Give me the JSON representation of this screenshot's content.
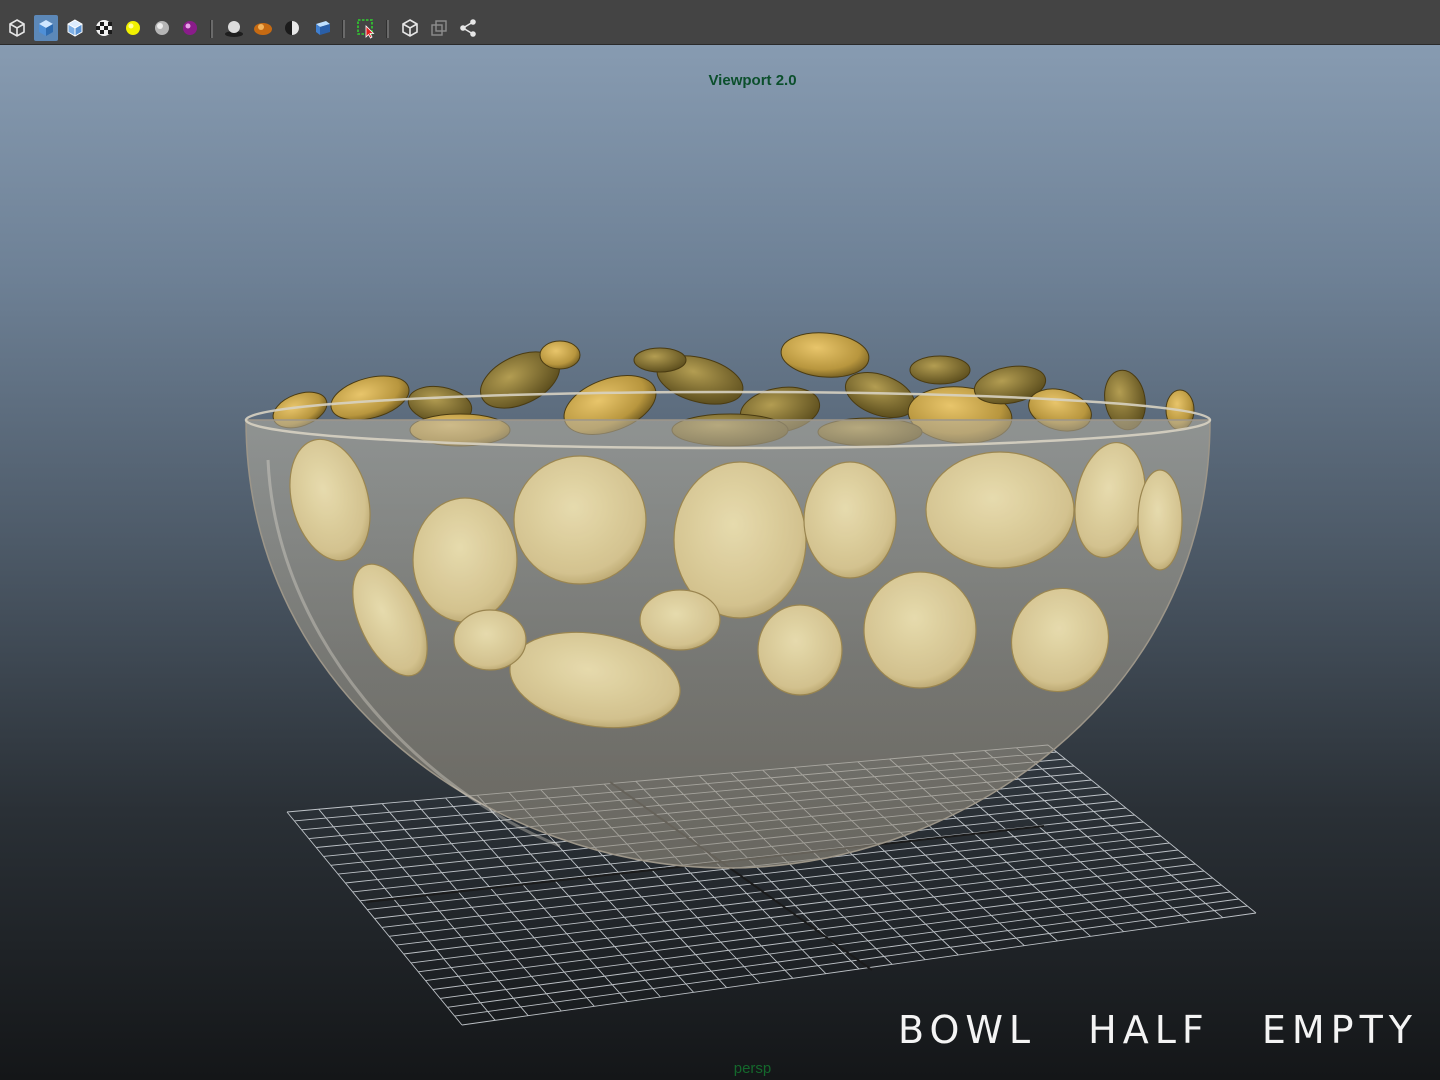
{
  "toolbar": {
    "tools": [
      {
        "icon": "wireframe-cube-icon",
        "active": false
      },
      {
        "icon": "smooth-shade-cube-icon",
        "active": true
      },
      {
        "icon": "wireframe-on-shaded-icon",
        "active": false
      },
      {
        "icon": "textured-checker-icon",
        "active": false
      },
      {
        "icon": "use-all-lights-icon",
        "active": false
      },
      {
        "icon": "default-material-sphere-icon",
        "active": false
      },
      {
        "icon": "shaded-material-sphere-icon",
        "active": false
      },
      {
        "icon": "shadows-icon",
        "active": false
      },
      {
        "icon": "screen-space-ao-icon",
        "active": false
      },
      {
        "icon": "half-shade-icon",
        "active": false
      },
      {
        "icon": "xray-cube-icon",
        "active": false
      },
      {
        "icon": "select-camera-icon",
        "active": false
      },
      {
        "icon": "isolate-select-cube-icon",
        "active": false
      },
      {
        "icon": "xray-active-components-icon",
        "active": false
      },
      {
        "icon": "node-graph-icon",
        "active": false
      }
    ]
  },
  "viewport": {
    "renderer_label": "Viewport 2.0",
    "camera_label": "persp",
    "caption": "BOWL HALF EMPTY"
  },
  "colors": {
    "toolbar_bg": "#444444",
    "active_tool": "#5c88b8",
    "renderer_label": "#0b4f2c",
    "camera_label": "#14682c",
    "caption": "#f4f4f4",
    "chip_gold": "#c9a94e",
    "chip_pale": "#e2d3a0",
    "grid_line": "#d8dde2"
  }
}
